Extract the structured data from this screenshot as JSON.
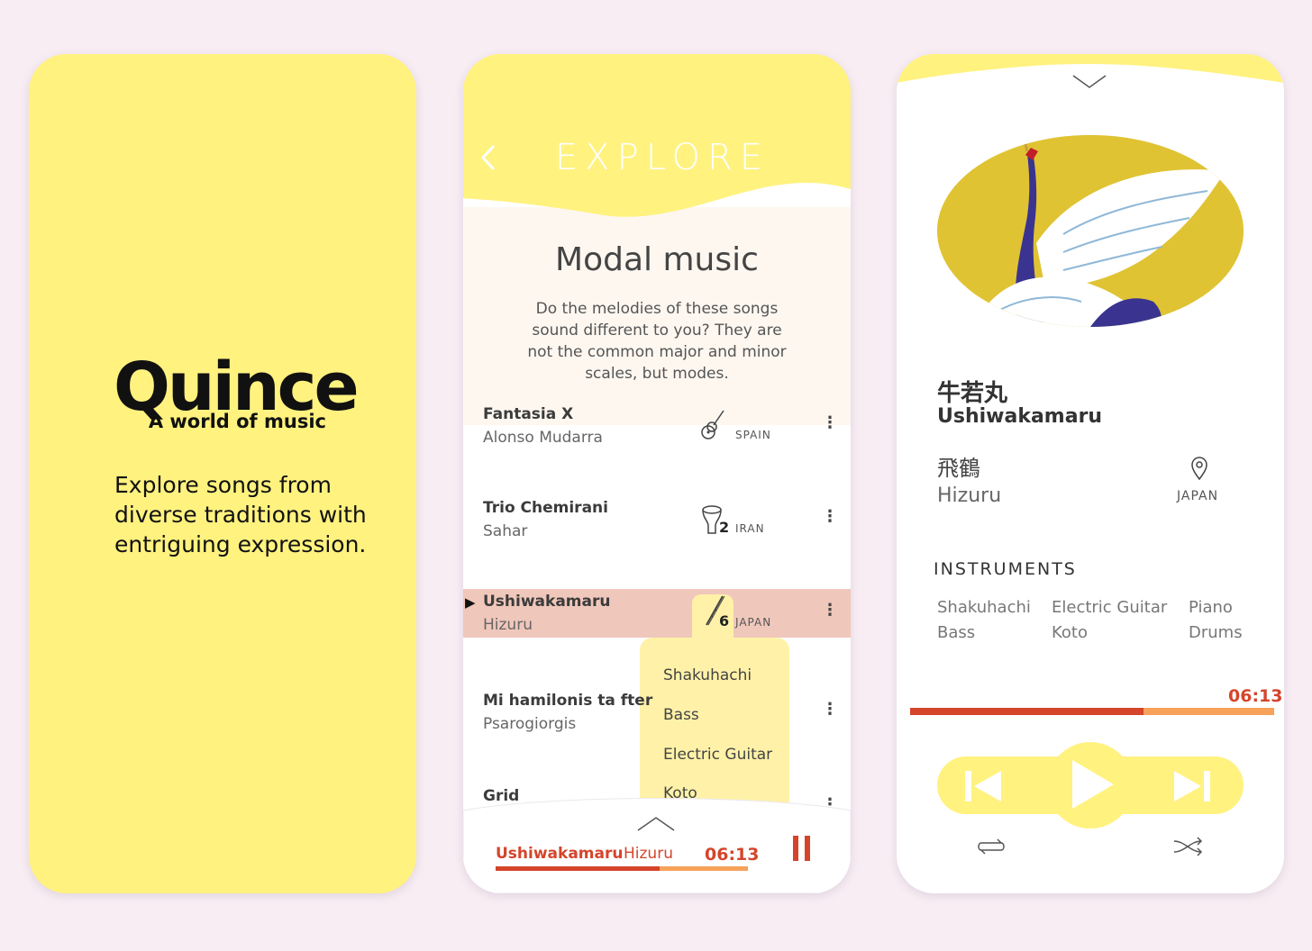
{
  "colors": {
    "background": "#f8edf3",
    "accent_yellow": "#fff27f",
    "highlight_row": "#f0c7bb",
    "progress_red": "#d4452b",
    "progress_orange": "#f7a15a"
  },
  "splash": {
    "logo": "Quince",
    "tagline": "A world of music",
    "description": "Explore songs from diverse traditions with entriguing expression."
  },
  "explore": {
    "header_title": "EXPLORE",
    "back_icon": "chevron-left-icon",
    "heading": "Modal music",
    "description": "Do the melodies of these songs sound different to you? They are not the common major and minor scales, but modes.",
    "songs": [
      {
        "title": "Fantasia X",
        "artist": "Alonso Mudarra",
        "icon": "guitar-icon",
        "count": "",
        "country": "SPAIN"
      },
      {
        "title": "Trio Chemirani",
        "artist": "Sahar",
        "icon": "drum-icon",
        "count": "2",
        "country": "IRAN"
      },
      {
        "title": "Ushiwakamaru",
        "artist": "Hizuru",
        "icon": "flute-icon",
        "count": "6",
        "country": "JAPAN"
      },
      {
        "title": "Mi hamilonis ta fter",
        "artist": "Psarogiorgis",
        "icon": "",
        "count": "",
        "country": ""
      },
      {
        "title": "Grid",
        "artist": "",
        "icon": "",
        "count": "",
        "country": ""
      }
    ],
    "active_index": 2,
    "instrument_dropdown": [
      "Shakuhachi",
      "Bass",
      "Electric Guitar",
      "Koto"
    ],
    "mini_player": {
      "title": "Ushiwakamaru",
      "artist": "Hizuru",
      "time": "06:13",
      "progress": 0.65
    }
  },
  "player": {
    "title_jp": "牛若丸",
    "title": "Ushiwakamaru",
    "artist_jp": "飛鶴",
    "artist": "Hizuru",
    "country": "JAPAN",
    "instruments_heading": "INSTRUMENTS",
    "instruments": [
      "Shakuhachi",
      "Electric Guitar",
      "Piano",
      "Bass",
      "Koto",
      "Drums"
    ],
    "time": "06:13",
    "progress": 0.64,
    "artwork": "crane-painting"
  }
}
